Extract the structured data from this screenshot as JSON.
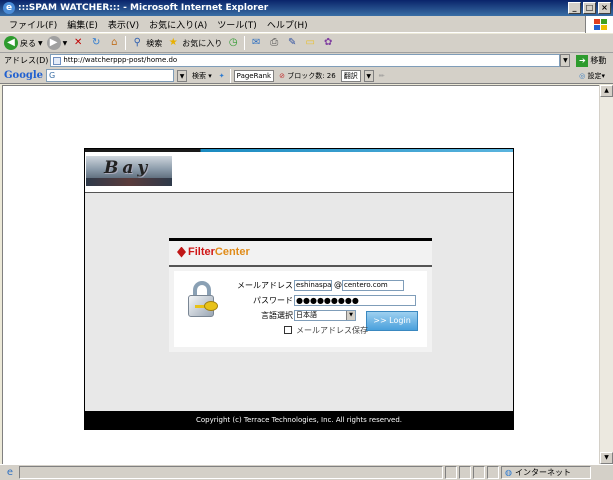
{
  "window": {
    "title": ":::SPAM WATCHER::: - Microsoft Internet Explorer",
    "buttons": [
      "_",
      "□",
      "×"
    ]
  },
  "menu": [
    "ファイル(F)",
    "編集(E)",
    "表示(V)",
    "お気に入り(A)",
    "ツール(T)",
    "ヘルプ(H)"
  ],
  "toolbar": {
    "back_label": "戻る",
    "search_label": "検索",
    "favorites_label": "お気に入り"
  },
  "address": {
    "label": "アドレス(D)",
    "url": "http://watcherppp-post/home.do",
    "go_label": "移動"
  },
  "googlebar": {
    "logo": "Google",
    "search_value": "G",
    "search_label": "検索",
    "pagerank_label": "PageRank",
    "blocked_label": "ブロック数: 26",
    "spell_label": "翻訳",
    "settings_label": "設定"
  },
  "page": {
    "header_logo_text": "Bay",
    "footer": "Copyright (c) Terrace Technologies, Inc. All rights reserved."
  },
  "login": {
    "logo_prefix": "Filter",
    "logo_suffix": "Center",
    "email_label": "メールアドレス",
    "email_user": "eshinaspam",
    "at": "@",
    "email_domain": "centero.com",
    "password_label": "パスワード",
    "password_value": "●●●●●●●●●",
    "language_label": "言語選択",
    "language_value": "日本語",
    "login_button": ">> Login",
    "save_email_label": "メールアドレス保存"
  },
  "statusbar": {
    "zone": "インターネット"
  }
}
